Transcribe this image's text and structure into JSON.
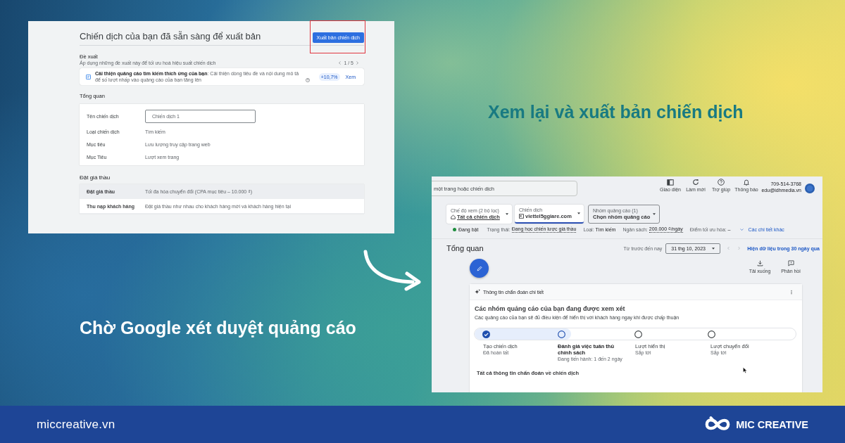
{
  "left_panel": {
    "title": "Chiến dịch của bạn đã sẵn sàng để xuất bản",
    "publish_button": {
      "label": "Xuất bản chiến dịch",
      "highlighted": true
    },
    "recommendations": {
      "heading": "Đề xuất",
      "subtitle": "Áp dụng những đề xuất này để tối ưu hoá hiệu suất chiến dịch",
      "pager": "1 / 5",
      "card": {
        "text": "**Cải thiện quảng cáo tìm kiếm thích ứng của bạn**: Cải thiện dòng tiêu đề và nội dung mô tả để số lượt nhấp vào quảng cáo của bạn tăng lên",
        "uplift": "+10,7%",
        "action": "Xem"
      }
    },
    "overview": {
      "heading": "Tổng quan",
      "rows": [
        {
          "kind": "input",
          "label": "Tên chiến dịch",
          "value": "Chiến dịch 1"
        },
        {
          "kind": "text",
          "label": "Loại chiến dịch",
          "value": "Tìm kiếm"
        },
        {
          "kind": "text",
          "label": "Mục tiêu",
          "value": "Lưu lượng truy cập trang web"
        },
        {
          "kind": "text",
          "label": "Mục Tiêu",
          "value": "Lượt xem trang"
        }
      ]
    },
    "bidding": {
      "heading": "Đặt giá thầu",
      "rows": [
        {
          "label": "Đặt giá thầu",
          "value": "Tối đa hóa chuyển đổi (CPA mục tiêu – 10.000 ₫)",
          "highlighted": true
        },
        {
          "label": "Thu nạp khách hàng",
          "value": "Đặt giá thầu như nhau cho khách hàng mới và khách hàng hiện tại",
          "highlighted": false
        }
      ]
    }
  },
  "caption_right": "Xem lại và xuất bản chiến dịch",
  "right_panel": {
    "search": {
      "placeholder": "một trang hoặc chiến dịch"
    },
    "toolbar": [
      {
        "label": "Giao diện"
      },
      {
        "label": "Làm mới"
      },
      {
        "label": "Trợ giúp"
      },
      {
        "label": "Thông báo"
      }
    ],
    "account": {
      "phone": "709-514-3768",
      "email": "edu@idhmedia.vn"
    },
    "filters": [
      {
        "kind": "filled",
        "label": "Chế độ xem (2 bộ lọc)",
        "value": "Tất cả chiến dịch",
        "selected": false
      },
      {
        "kind": "filled",
        "label": "Chiến dịch",
        "value": "viettel5ggiare.com",
        "selected": true
      },
      {
        "kind": "outlined",
        "label": "Nhóm quảng cáo (1)",
        "value": "Chọn nhóm quảng cáo",
        "selected": false
      }
    ],
    "status": {
      "enabled": true,
      "label": "Đang bật",
      "items": [
        {
          "kind": "link",
          "label": "Trạng thái:",
          "value": "Đang học chiến lược giá thầu"
        },
        {
          "kind": "text",
          "label": "Loại:",
          "value": "Tìm kiếm"
        },
        {
          "kind": "link",
          "label": "Ngân sách:",
          "value": "200.000 ₫/ngày"
        },
        {
          "kind": "text",
          "label": "Điểm tối ưu hóa:",
          "value": "–"
        }
      ],
      "more_link": "Các chi tiết khác"
    },
    "header": {
      "title": "Tổng quan",
      "range_label": "Từ trước đến nay",
      "date": "31 thg 10, 2023",
      "data_link": "Hiện dữ liệu trong 30 ngày qua"
    },
    "actions": [
      {
        "label": "Tải xuống"
      },
      {
        "label": "Phản hồi"
      }
    ],
    "diagnostics": {
      "header": "Thông tin chẩn đoán chi tiết",
      "title": "Các nhóm quảng cáo của bạn đang được xem xét",
      "subtitle": "Các quảng cáo của bạn sẽ đủ điều kiện để hiển thị với khách hàng ngay khi được chấp thuận",
      "progress": {
        "level": 0.3
      },
      "steps": [
        {
          "completed": true,
          "active": false,
          "title": "Tạo chiến dịch",
          "status": "Đã hoàn tất"
        },
        {
          "completed": false,
          "active": true,
          "title": "Đánh giá việc tuân thủ chính sách",
          "status": "Đang tiến hành: 1 đến 2 ngày"
        },
        {
          "completed": false,
          "active": false,
          "title": "Lượt hiển thị",
          "status": "Sắp tới"
        },
        {
          "completed": false,
          "active": false,
          "title": "Lượt chuyển đổi",
          "status": "Sắp tới"
        }
      ],
      "section_heading": "Tất cả thông tin chẩn đoán về chiến dịch"
    }
  },
  "caption_left": "Chờ Google xét duyệt quảng cáo",
  "footer": {
    "website": "miccreative.vn",
    "brand": "MIC CREATIVE"
  }
}
